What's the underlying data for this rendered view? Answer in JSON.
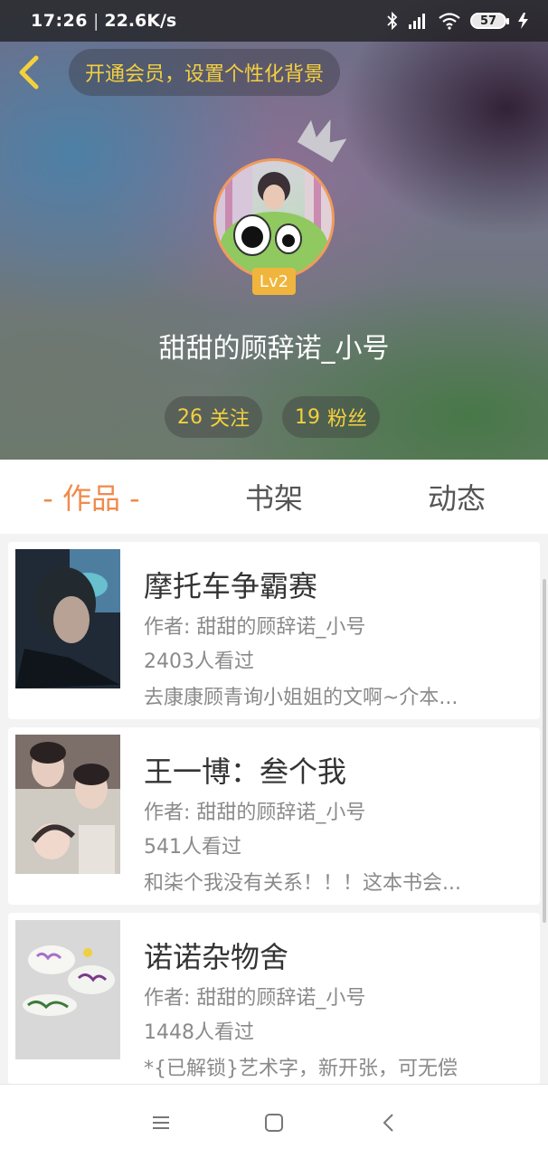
{
  "status_bar": {
    "time": "17:26",
    "speed": "22.6K/s",
    "battery": "57",
    "icons": [
      "bluetooth-icon",
      "signal-icon",
      "wifi-icon",
      "battery-icon",
      "charging-icon"
    ]
  },
  "header": {
    "vip_banner": "开通会员，设置个性化背景",
    "username": "甜甜的顾辞诺_小号",
    "level": "Lv2",
    "following": {
      "count": "26",
      "label": "关注"
    },
    "followers": {
      "count": "19",
      "label": "粉丝"
    }
  },
  "tabs": [
    {
      "label": "- 作品 -",
      "active": true
    },
    {
      "label": "书架",
      "active": false
    },
    {
      "label": "动态",
      "active": false
    }
  ],
  "books": [
    {
      "title": "摩托车争霸赛",
      "author": "作者: 甜甜的顾辞诺_小号",
      "views": "2403人看过",
      "desc": "去康康顾青询小姐姐的文啊~介本..."
    },
    {
      "title": "王一博：叁个我",
      "author": "作者: 甜甜的顾辞诺_小号",
      "views": "541人看过",
      "desc": "和柒个我没有关系！！！这本书会..."
    },
    {
      "title": "诺诺杂物舍",
      "author": "作者: 甜甜的顾辞诺_小号",
      "views": "1448人看过",
      "desc": "*{已解锁}艺术字，新开张，可无偿"
    }
  ],
  "colors": {
    "accent": "#f08a4b",
    "gold": "#f4d03f",
    "level_badge": "#f0b53c"
  }
}
